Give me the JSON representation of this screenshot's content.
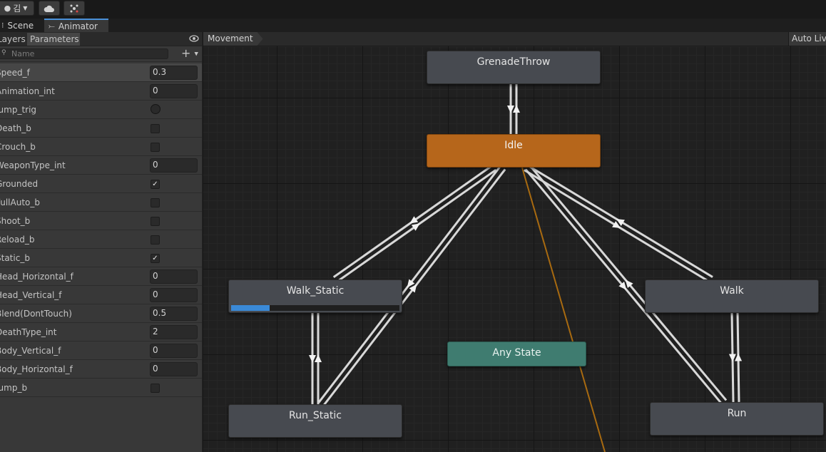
{
  "toolbar": {
    "account_label": "김",
    "account_icon": "account-icon",
    "cloud_icon": "cloud-icon",
    "collab_icon": "collab-icon"
  },
  "tabs": [
    {
      "label": "Scene",
      "icon": "scene-icon",
      "active": false
    },
    {
      "label": "Animator",
      "icon": "animator-icon",
      "active": true
    }
  ],
  "panel": {
    "tabs": [
      "Layers",
      "Parameters"
    ],
    "active_tab": "Parameters",
    "search_placeholder": "Name",
    "add_label": "+",
    "visibility_icon": "eye-icon"
  },
  "parameters": [
    {
      "name": "Speed_f",
      "type": "float",
      "value": "0.3"
    },
    {
      "name": "Animation_int",
      "type": "int",
      "value": "0"
    },
    {
      "name": "Jump_trig",
      "type": "trigger",
      "value": false
    },
    {
      "name": "Death_b",
      "type": "bool",
      "value": false
    },
    {
      "name": "Crouch_b",
      "type": "bool",
      "value": false
    },
    {
      "name": "WeaponType_int",
      "type": "int",
      "value": "0"
    },
    {
      "name": "Grounded",
      "type": "bool",
      "value": true
    },
    {
      "name": "FullAuto_b",
      "type": "bool",
      "value": false
    },
    {
      "name": "Shoot_b",
      "type": "bool",
      "value": false
    },
    {
      "name": "Reload_b",
      "type": "bool",
      "value": false
    },
    {
      "name": "Static_b",
      "type": "bool",
      "value": true
    },
    {
      "name": "Head_Horizontal_f",
      "type": "float",
      "value": "0"
    },
    {
      "name": "Head_Vertical_f",
      "type": "float",
      "value": "0"
    },
    {
      "name": "Blend(DontTouch)",
      "type": "float",
      "value": "0.5"
    },
    {
      "name": "DeathType_int",
      "type": "int",
      "value": "2"
    },
    {
      "name": "Body_Vertical_f",
      "type": "float",
      "value": "0"
    },
    {
      "name": "Body_Horizontal_f",
      "type": "float",
      "value": "0"
    },
    {
      "name": "Jump_b",
      "type": "bool",
      "value": false
    }
  ],
  "graph": {
    "breadcrumb": "Movement",
    "auto_live_label": "Auto Live Link",
    "states": [
      {
        "id": "grenade",
        "label": "GrenadeThrow",
        "kind": "normal"
      },
      {
        "id": "idle",
        "label": "Idle",
        "kind": "default"
      },
      {
        "id": "walk_static",
        "label": "Walk_Static",
        "kind": "normal",
        "progress": 0.23
      },
      {
        "id": "walk",
        "label": "Walk",
        "kind": "normal"
      },
      {
        "id": "any",
        "label": "Any State",
        "kind": "any"
      },
      {
        "id": "run_static",
        "label": "Run_Static",
        "kind": "normal"
      },
      {
        "id": "run",
        "label": "Run",
        "kind": "normal"
      }
    ],
    "colors": {
      "default_state": "#b6661b",
      "any_state": "#3f7c70",
      "transition": "#d8d8d8",
      "active_transition": "#a86a10",
      "progress": "#3a8ad8"
    }
  }
}
